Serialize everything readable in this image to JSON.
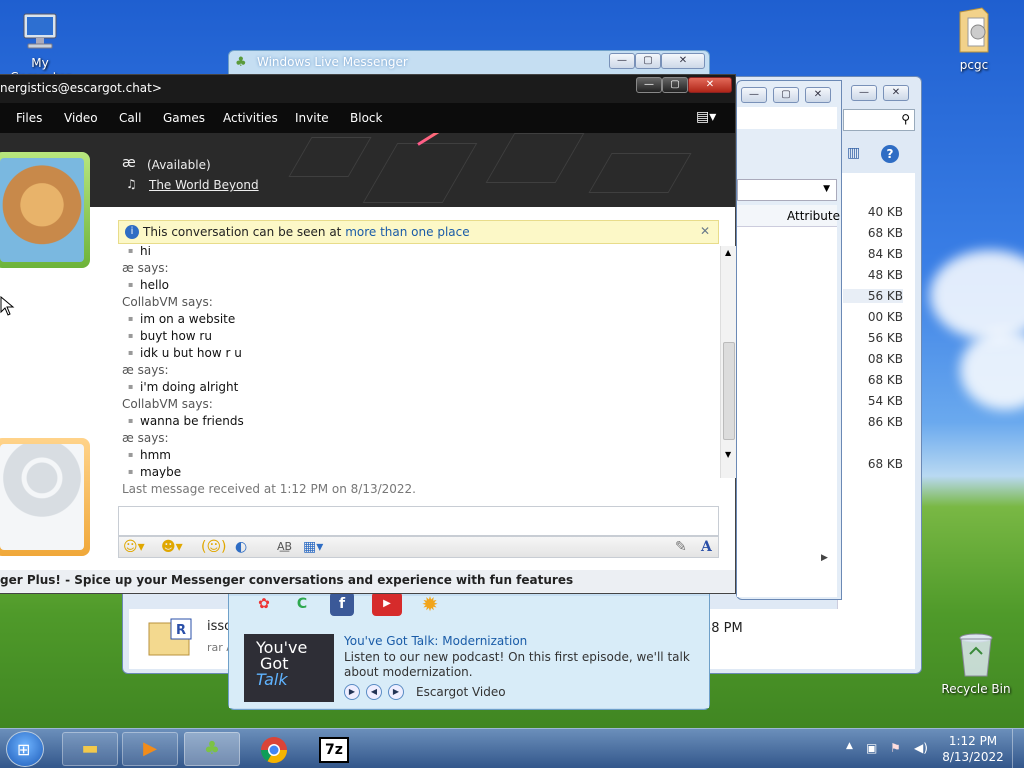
{
  "desktop": {
    "icons": [
      {
        "label": "My Computer",
        "icon": "computer-icon"
      },
      {
        "label": "pcgc",
        "icon": "folder-icon"
      },
      {
        "label": "Recycle Bin",
        "icon": "recycle-bin-icon"
      }
    ]
  },
  "explorer": {
    "sizes": [
      "40 KB",
      "68 KB",
      "84 KB",
      "48 KB",
      "56 KB",
      "00 KB",
      "56 KB",
      "08 KB",
      "68 KB",
      "54 KB",
      "86 KB",
      "68 KB"
    ],
    "column_header": "Attribute",
    "file": {
      "name": "isso",
      "sub": "rar A",
      "time": "58 PM"
    }
  },
  "messenger_main": {
    "title": "Windows Live Messenger",
    "promo": {
      "image_text": [
        "You've",
        "Got",
        "Talk"
      ],
      "title": "You've Got Talk: Modernization",
      "text": "Listen to our new podcast! On this first episode, we'll talk about modernization.",
      "source": "Escargot Video"
    }
  },
  "conversation": {
    "title": "nergistics@escargot.chat>",
    "menu": [
      "Files",
      "Video",
      "Call",
      "Games",
      "Activities",
      "Invite",
      "Block"
    ],
    "contact": {
      "name": "æ",
      "status": "(Available)",
      "song": "The World Beyond"
    },
    "notice": {
      "text": "This conversation can be seen at ",
      "link": "more than one place"
    },
    "messages": [
      {
        "type": "bullet",
        "text": "hi"
      },
      {
        "type": "sender",
        "text": "æ says:"
      },
      {
        "type": "bullet",
        "text": "hello"
      },
      {
        "type": "sender",
        "text": "CollabVM says:"
      },
      {
        "type": "bullet",
        "text": "im on a website"
      },
      {
        "type": "bullet",
        "text": "buyt how ru"
      },
      {
        "type": "bullet",
        "text": "idk u but how r u"
      },
      {
        "type": "sender",
        "text": "æ says:"
      },
      {
        "type": "bullet",
        "text": "i'm doing alright"
      },
      {
        "type": "sender",
        "text": "CollabVM says:"
      },
      {
        "type": "bullet",
        "text": "wanna be friends"
      },
      {
        "type": "sender",
        "text": "æ says:"
      },
      {
        "type": "bullet",
        "text": "hmm"
      },
      {
        "type": "bullet",
        "text": "maybe"
      }
    ],
    "last_message": "Last message received at 1:12 PM on 8/13/2022.",
    "footer_ad": "ger Plus! - Spice up your Messenger conversations and experience with fun features"
  },
  "taskbar": {
    "time": "1:12 PM",
    "date": "8/13/2022",
    "apps": [
      "explorer",
      "media-player",
      "messenger",
      "chrome",
      "7zip"
    ],
    "app_labels": {
      "sevenzip": "7z"
    }
  },
  "colors": {
    "link": "#1a5ca8",
    "notice_bg": "#fcf8c7",
    "titlebar_dark": "#1b1b1b",
    "avatar_green": "#7cc245",
    "avatar_orange": "#f0a83a"
  }
}
